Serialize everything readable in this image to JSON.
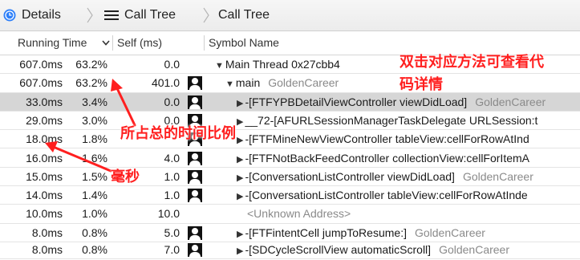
{
  "topbar": {
    "details_label": "Details",
    "call_tree_label_1": "Call Tree",
    "call_tree_label_2": "Call Tree"
  },
  "columns": {
    "running_time": "Running Time",
    "self": "Self (ms)",
    "symbol": "Symbol Name"
  },
  "rows": [
    {
      "ms": "607.0ms",
      "pct": "63.2%",
      "self": "0.0",
      "user_icon": false,
      "triangle": "▼",
      "symbol": "Main Thread  0x27cbb4",
      "module": ""
    },
    {
      "ms": "607.0ms",
      "pct": "63.2%",
      "self": "401.0",
      "user_icon": true,
      "triangle": "▼",
      "symbol": "main",
      "module": "GoldenCareer"
    },
    {
      "ms": "33.0ms",
      "pct": "3.4%",
      "self": "0.0",
      "user_icon": true,
      "triangle": "▶",
      "symbol": "-[FTFYPBDetailViewController viewDidLoad]",
      "module": "GoldenCareer"
    },
    {
      "ms": "29.0ms",
      "pct": "3.0%",
      "self": "0.0",
      "user_icon": true,
      "triangle": "▶",
      "symbol": "__72-[AFURLSessionManagerTaskDelegate URLSession:t",
      "module": ""
    },
    {
      "ms": "18.0ms",
      "pct": "1.8%",
      "self": "",
      "user_icon": true,
      "triangle": "▶",
      "symbol": "-[FTFMineNewViewController tableView:cellForRowAtInd",
      "module": ""
    },
    {
      "ms": "16.0ms",
      "pct": "1.6%",
      "self": "4.0",
      "user_icon": true,
      "triangle": "▶",
      "symbol": "-[FTFNotBackFeedController collectionView:cellForItemA",
      "module": ""
    },
    {
      "ms": "15.0ms",
      "pct": "1.5%",
      "self": "1.0",
      "user_icon": true,
      "triangle": "▶",
      "symbol": "-[ConversationListController viewDidLoad]",
      "module": "GoldenCareer"
    },
    {
      "ms": "14.0ms",
      "pct": "1.4%",
      "self": "1.0",
      "user_icon": true,
      "triangle": "▶",
      "symbol": "-[ConversationListController tableView:cellForRowAtInde",
      "module": ""
    },
    {
      "ms": "10.0ms",
      "pct": "1.0%",
      "self": "10.0",
      "user_icon": false,
      "triangle": "",
      "symbol": "<Unknown Address>",
      "module": ""
    },
    {
      "ms": "8.0ms",
      "pct": "0.8%",
      "self": "5.0",
      "user_icon": true,
      "triangle": "▶",
      "symbol": "-[FTFintentCell jumpToResume:]",
      "module": "GoldenCareer"
    },
    {
      "ms": "8.0ms",
      "pct": "0.8%",
      "self": "7.0",
      "user_icon": true,
      "triangle": "▶",
      "symbol": "-[SDCycleScrollView automaticScroll]",
      "module": "GoldenCareer"
    }
  ],
  "annotations": {
    "double_click": "双击对应方法可查看代",
    "double_click_2": "码详情",
    "percentage": "所占总的时间比例",
    "ms": "毫秒"
  },
  "colors": {
    "selection": "#d6d6d6",
    "annotation": "#ff1f1f"
  }
}
